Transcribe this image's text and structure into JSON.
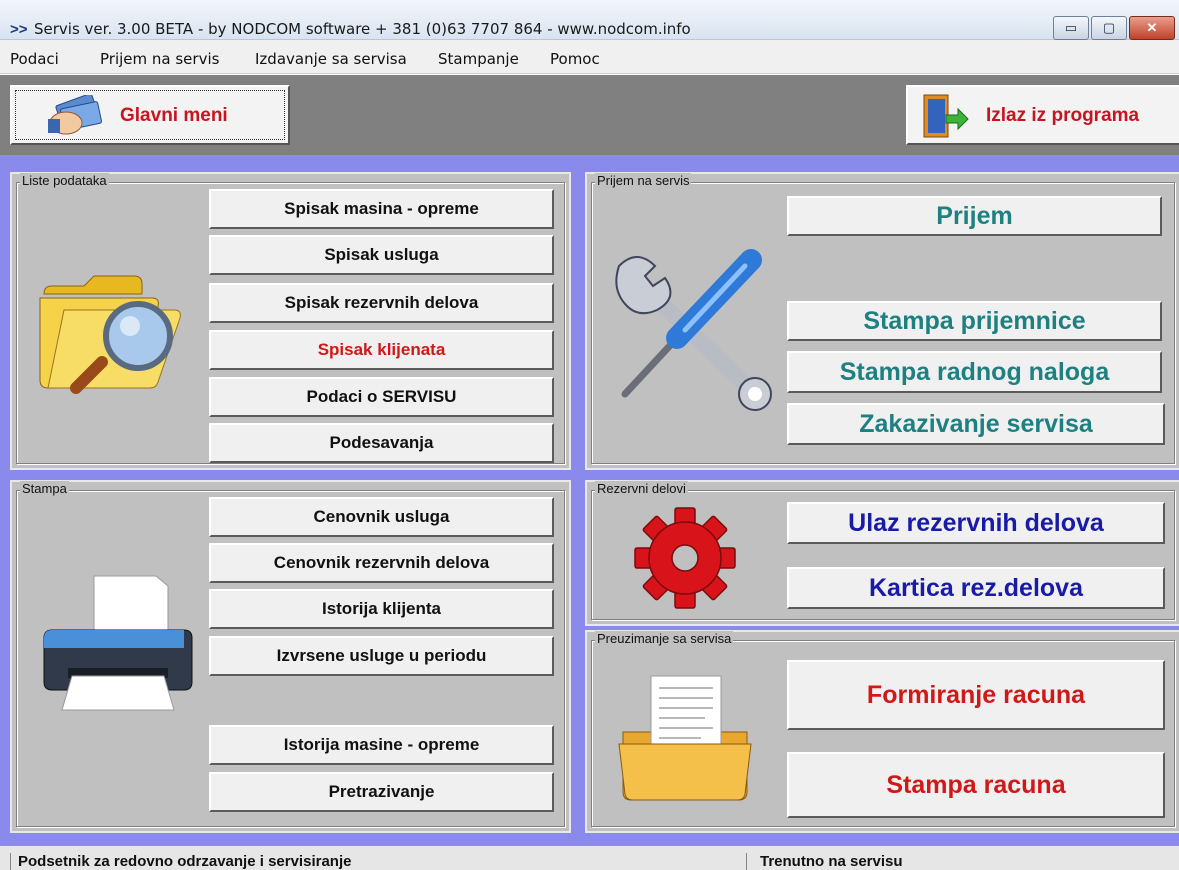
{
  "window": {
    "title": "Servis ver. 3.00 BETA - by NODCOM software  + 381 (0)63 7707 864 - www.nodcom.info",
    "app_icon": ">>",
    "minimize": "▭",
    "maximize": "▢",
    "close": "✕"
  },
  "menu": [
    "Podaci",
    "Prijem na servis",
    "Izdavanje sa servisa",
    "Stampanje",
    "Pomoc"
  ],
  "toolbar": {
    "main_menu": "Glavni meni",
    "exit": "Izlaz iz programa"
  },
  "panels": {
    "liste": {
      "title": "Liste podataka",
      "buttons": [
        "Spisak masina - opreme",
        "Spisak usluga",
        "Spisak rezervnih delova",
        "Spisak klijenata",
        "Podaci o SERVISU",
        "Podesavanja"
      ]
    },
    "prijem": {
      "title": "Prijem na servis",
      "buttons": [
        "Prijem",
        "Stampa prijemnice",
        "Stampa radnog naloga",
        "Zakazivanje servisa"
      ]
    },
    "stampa": {
      "title": "Stampa",
      "buttons": [
        "Cenovnik usluga",
        "Cenovnik rezervnih delova",
        "Istorija klijenta",
        "Izvrsene usluge u periodu",
        "Istorija masine - opreme",
        "Pretrazivanje"
      ]
    },
    "rezervni": {
      "title": "Rezervni delovi",
      "buttons": [
        "Ulaz rezervnih delova",
        "Kartica rez.delova"
      ]
    },
    "preuzimanje": {
      "title": "Preuzimanje sa servisa",
      "buttons": [
        "Formiranje racuna",
        "Stampa racuna"
      ]
    }
  },
  "status": {
    "left": "Podsetnik za redovno odrzavanje i servisiranje",
    "right": "Trenutno na servisu"
  },
  "colors": {
    "workspace_bg": "#8a8aed",
    "panel_bg": "#c0c0c0",
    "teal_text": "#1e8080",
    "navy_text": "#1a1aa8",
    "red_text": "#d01818"
  }
}
